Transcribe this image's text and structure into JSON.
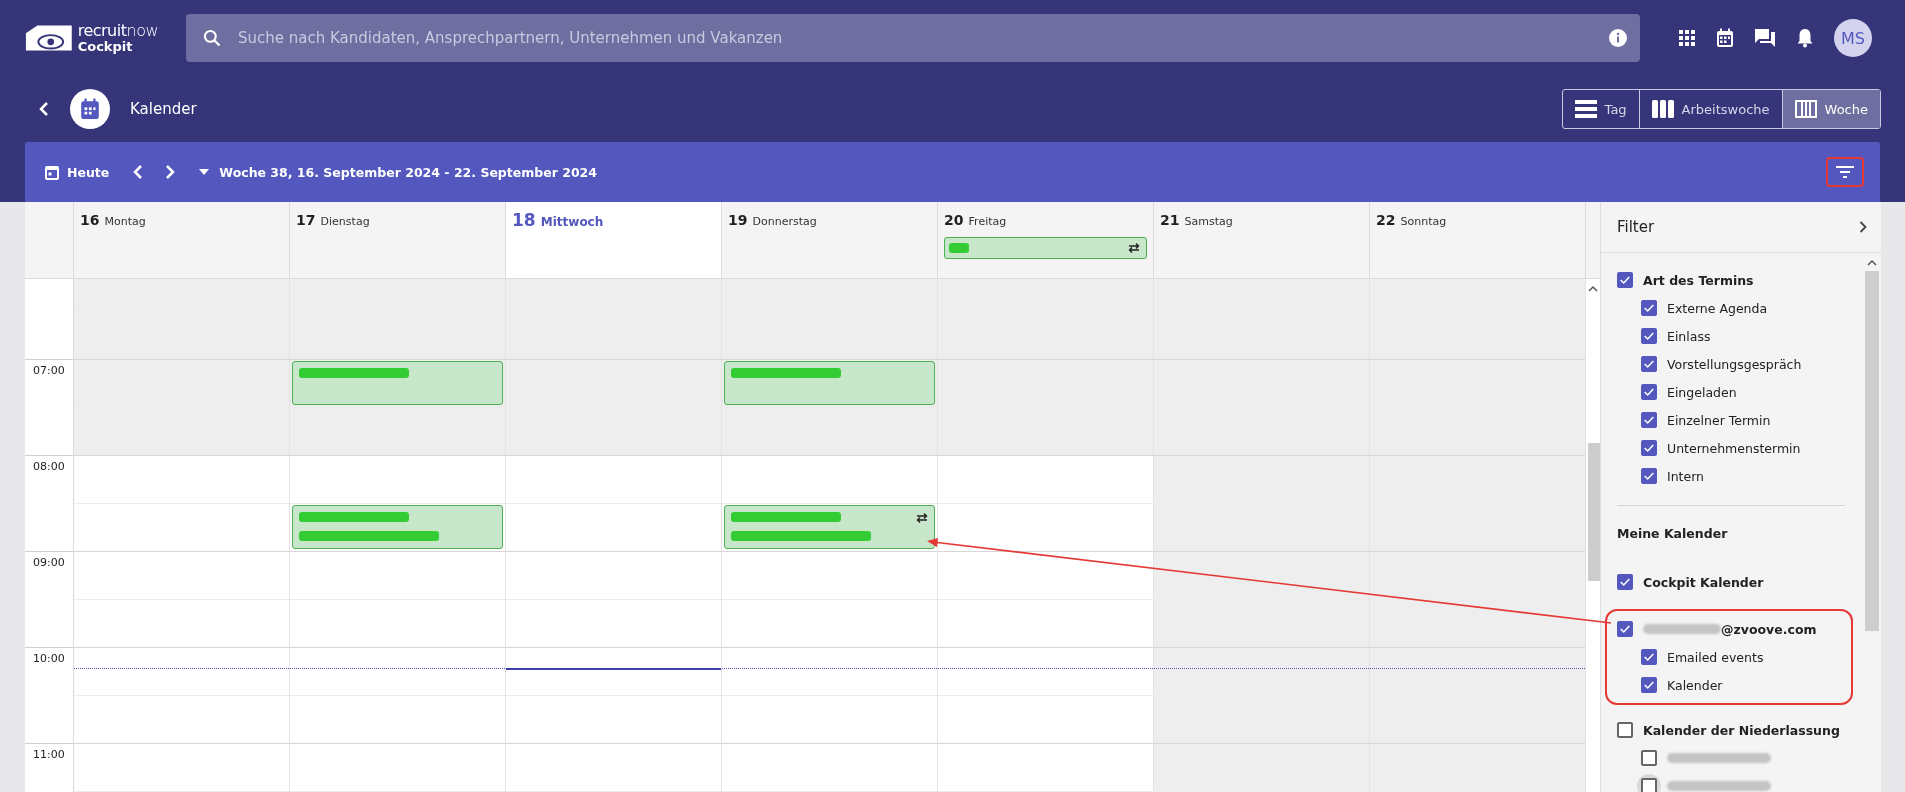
{
  "header": {
    "brand": "**recruit**now",
    "product": "Cockpit",
    "search_placeholder": "Suche nach Kandidaten, Ansprechpartnern, Unternehmen und Vakanzen",
    "avatar": "MS"
  },
  "page": {
    "title": "Kalender",
    "views": [
      {
        "label": "Tag",
        "kind": "day",
        "selected": false
      },
      {
        "label": "Arbeitswoche",
        "kind": "workweek",
        "selected": false
      },
      {
        "label": "Woche",
        "kind": "week",
        "selected": true
      }
    ]
  },
  "toolbar": {
    "today": "Heute",
    "range": "Woche 38, 16. September 2024 - 22. September 2024",
    "filter_highlighted": true
  },
  "calendar": {
    "early_hours_shaded": true,
    "now_line": true,
    "times": [
      "07:00",
      "08:00",
      "09:00",
      "10:00",
      "11:00"
    ],
    "days": [
      {
        "number": "16",
        "name": "Montag",
        "today": false,
        "weekend": false
      },
      {
        "number": "17",
        "name": "Dienstag",
        "today": false,
        "weekend": false,
        "events": [
          {
            "early_hours": true,
            "recurring": false,
            "wrapped": false
          },
          {
            "early_hours": false,
            "recurring": false,
            "wrapped": true
          }
        ]
      },
      {
        "number": "18",
        "name": "Mittwoch",
        "today": true,
        "weekend": false
      },
      {
        "number": "19",
        "name": "Donnerstag",
        "today": false,
        "weekend": false,
        "events": [
          {
            "early_hours": true,
            "recurring": false,
            "wrapped": false
          },
          {
            "early_hours": false,
            "recurring": true,
            "wrapped": true
          }
        ]
      },
      {
        "number": "20",
        "name": "Freitag",
        "today": false,
        "weekend": false,
        "all_day": [
          {
            "recurring": true
          }
        ]
      },
      {
        "number": "21",
        "name": "Samstag",
        "today": false,
        "weekend": true
      },
      {
        "number": "22",
        "name": "Sonntag",
        "today": false,
        "weekend": true
      }
    ]
  },
  "filter": {
    "title": "Filter",
    "items": [
      {
        "kind": "group",
        "label": "Art des Termins",
        "checked": true,
        "children": [
          {
            "label": "Externe Agenda",
            "checked": true
          },
          {
            "label": "Einlass",
            "checked": true
          },
          {
            "label": "Vorstellungsgespräch",
            "checked": true
          },
          {
            "label": "Eingeladen",
            "checked": true
          },
          {
            "label": "Einzelner Termin",
            "checked": true
          },
          {
            "label": "Unternehmenstermin",
            "checked": true
          },
          {
            "label": "Intern",
            "checked": true
          }
        ]
      },
      {
        "kind": "divider"
      },
      {
        "kind": "heading",
        "label": "Meine Kalender"
      },
      {
        "kind": "group",
        "label": "Cockpit Kalender",
        "checked": true
      },
      {
        "kind": "group",
        "label": "@zvoove.com",
        "blurred_prefix": true,
        "highlighted": true,
        "checked": true,
        "children": [
          {
            "label": "Emailed events",
            "checked": true
          },
          {
            "label": "Kalender",
            "checked": true
          }
        ]
      },
      {
        "kind": "group",
        "label": "Kalender der Niederlassung",
        "checked": false,
        "children": [
          {
            "blurred": true,
            "checked": false
          },
          {
            "blurred": true,
            "checked": false,
            "focused": true
          }
        ]
      }
    ]
  }
}
